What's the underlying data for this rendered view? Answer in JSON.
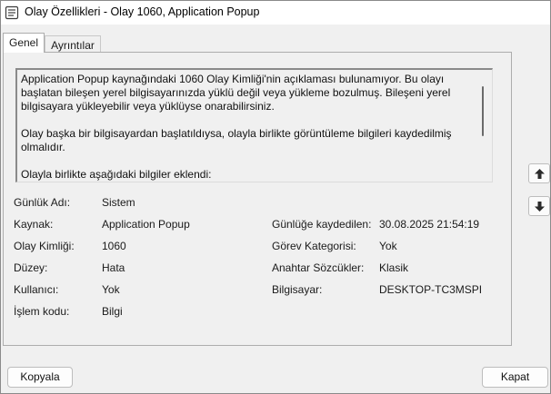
{
  "window": {
    "title": "Olay Özellikleri - Olay 1060, Application Popup"
  },
  "tabs": [
    {
      "label": "Genel"
    },
    {
      "label": "Ayrıntılar"
    }
  ],
  "description": {
    "paragraphs": [
      "Application Popup kaynağındaki 1060 Olay Kimliği'nin açıklaması bulunamıyor. Bu olayı başlatan bileşen yerel bilgisayarınızda yüklü değil veya yükleme bozulmuş. Bileşeni yerel bilgisayara yükleyebilir veya yüklüyse onarabilirsiniz.",
      "Olay başka bir bilgisayardan başlatıldıysa, olayla birlikte görüntüleme bilgileri kaydedilmiş olmalıdır.",
      "Olayla birlikte aşağıdaki bilgiler eklendi:"
    ]
  },
  "fields": {
    "log_name": {
      "label": "Günlük Adı:",
      "value": "Sistem"
    },
    "source": {
      "label": "Kaynak:",
      "value": "Application Popup"
    },
    "event_id": {
      "label": "Olay Kimliği:",
      "value": "1060"
    },
    "level": {
      "label": "Düzey:",
      "value": "Hata"
    },
    "user": {
      "label": "Kullanıcı:",
      "value": "Yok"
    },
    "opcode": {
      "label": "İşlem kodu:",
      "value": "Bilgi"
    },
    "logged": {
      "label": "Günlüğe kaydedilen:",
      "value": "30.08.2025 21:54:19"
    },
    "task_category": {
      "label": "Görev Kategorisi:",
      "value": "Yok"
    },
    "keywords": {
      "label": "Anahtar Sözcükler:",
      "value": "Klasik"
    },
    "computer": {
      "label": "Bilgisayar:",
      "value": "DESKTOP-TC3MSPI"
    }
  },
  "buttons": {
    "copy": "Kopyala",
    "close": "Kapat"
  },
  "icons": {
    "window": "event-properties-icon",
    "up": "arrow-up-icon",
    "down": "arrow-down-icon"
  }
}
